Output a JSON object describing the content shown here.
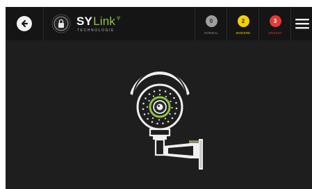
{
  "header": {
    "back_icon": "arrow-left-icon",
    "brand": {
      "name_part1": "SY",
      "name_part2": "Link",
      "subtitle": "TECHNOLOGIE",
      "logo_icon": "lock-seal-icon"
    },
    "alerts": [
      {
        "count": "0",
        "label": "NORMAL",
        "badge_color": "#9e9e9e",
        "text_color": "#8a8a8a",
        "count_color": "#2a2a2a"
      },
      {
        "count": "2",
        "label": "MODERE",
        "badge_color": "#f5d000",
        "text_color": "#f5d000",
        "count_color": "#2a2a2a"
      },
      {
        "count": "3",
        "label": "URGENT",
        "badge_color": "#e53935",
        "text_color": "#e53935",
        "count_color": "#ffffff"
      }
    ],
    "menu_icon": "hamburger-menu-icon"
  },
  "main": {
    "illustration": "security-camera-icon",
    "accent_color": "#8ec63f"
  }
}
